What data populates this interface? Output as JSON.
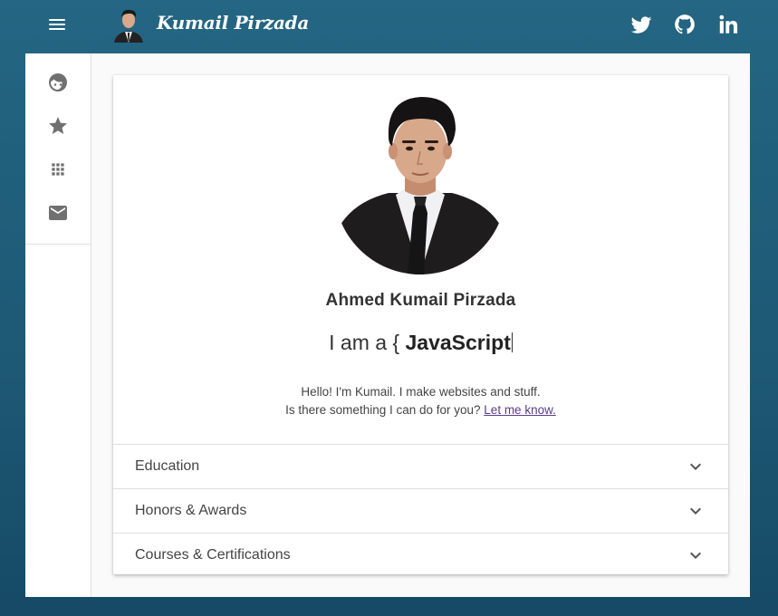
{
  "header": {
    "brand": "Kumail Pirzada",
    "social": [
      "twitter-icon",
      "github-icon",
      "linkedin-icon"
    ]
  },
  "sidebar": {
    "items": [
      {
        "icon": "face-icon"
      },
      {
        "icon": "star-icon"
      },
      {
        "icon": "apps-grid-icon"
      },
      {
        "icon": "mail-icon"
      }
    ]
  },
  "profile": {
    "name": "Ahmed Kumail Pirzada",
    "typing_prefix": "I am a {",
    "typing_word": "JavaScript",
    "blurb_line1": "Hello! I'm Kumail. I make websites and stuff.",
    "blurb_line2": "Is there something I can do for you?",
    "contact_link": "Let me know."
  },
  "sections": [
    {
      "label": "Education"
    },
    {
      "label": "Honors & Awards"
    },
    {
      "label": "Courses & Certifications"
    }
  ],
  "colors": {
    "background": "#1d5874",
    "card": "#ffffff",
    "link": "#5b3c88",
    "icon": "#707070"
  }
}
